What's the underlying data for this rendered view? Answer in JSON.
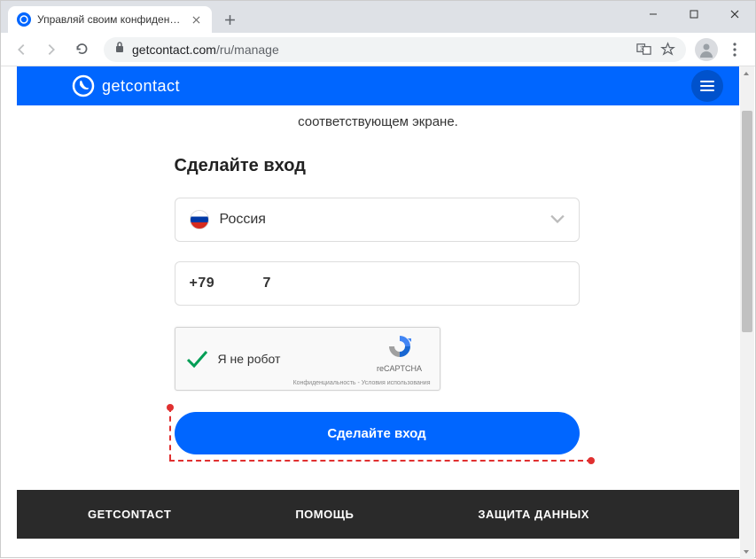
{
  "window": {
    "tab_title": "Управляй своим конфиденциал",
    "url_domain": "getcontact.com",
    "url_path": "/ru/manage"
  },
  "header": {
    "brand": "getcontact"
  },
  "main": {
    "subtitle": "соответствующем экране.",
    "section_title": "Сделайте вход",
    "country": "Россия",
    "phone_value": "+79           7",
    "recaptcha_label": "Я не робот",
    "recaptcha_brand": "reCAPTCHA",
    "recaptcha_links": "Конфиденциальность - Условия использования",
    "login_button": "Сделайте вход"
  },
  "footer": {
    "col1": "GETCONTACT",
    "col2": "ПОМОЩЬ",
    "col3": "ЗАЩИТА ДАННЫХ"
  }
}
